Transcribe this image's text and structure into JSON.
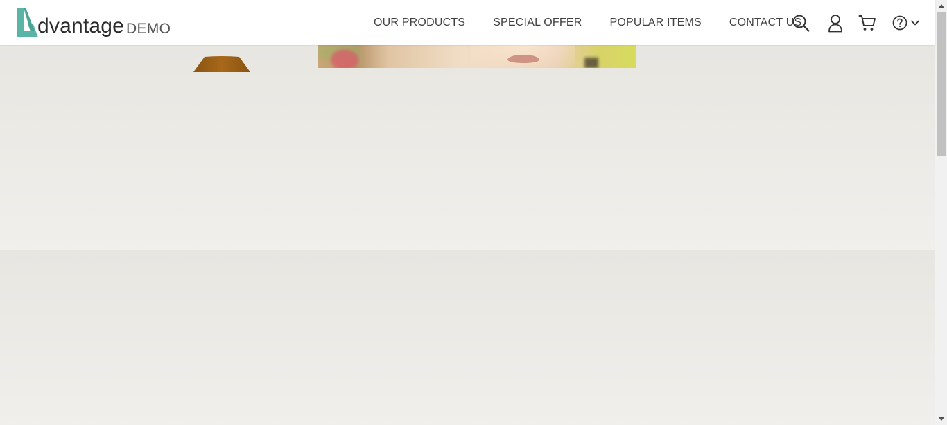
{
  "header": {
    "logo": {
      "word": "dvantage",
      "suffix": "DEMO",
      "brand_color": "#5bb5a7"
    },
    "nav": [
      {
        "label": "OUR PRODUCTS"
      },
      {
        "label": "SPECIAL OFFER"
      },
      {
        "label": "POPULAR ITEMS"
      },
      {
        "label": "CONTACT US"
      }
    ],
    "icons": [
      "search-icon",
      "user-icon",
      "cart-icon",
      "help-icon",
      "chevron-down-icon"
    ]
  },
  "colors": {
    "header_bg": "#ffffff",
    "page_bg": "#ebe9e4",
    "nav_text": "#414141"
  }
}
